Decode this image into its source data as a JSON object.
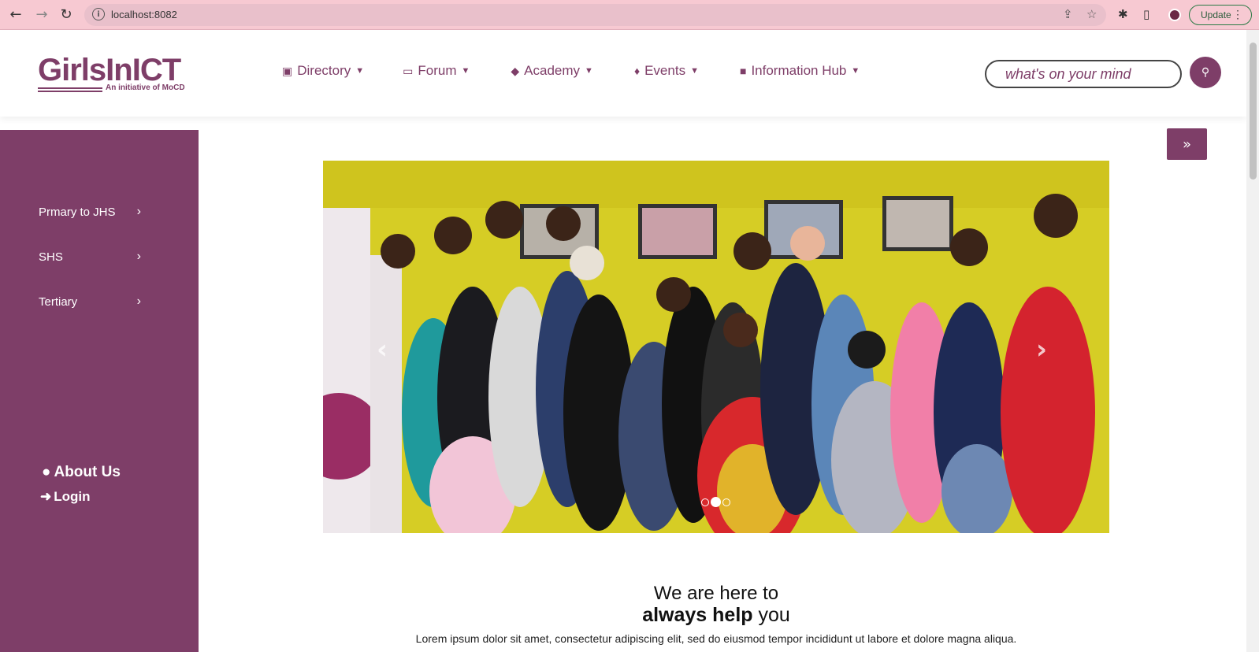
{
  "browser": {
    "url": "localhost:8082",
    "update_label": "Update"
  },
  "site": {
    "logo_text": "GirlsInICT",
    "logo_tagline": "An initiative of MoCD",
    "nav": [
      {
        "label": "Directory",
        "icon": "address-book-icon"
      },
      {
        "label": "Forum",
        "icon": "folder-open-icon"
      },
      {
        "label": "Academy",
        "icon": "graduation-cap-icon"
      },
      {
        "label": "Events",
        "icon": "fire-icon"
      },
      {
        "label": "Information Hub",
        "icon": "archive-icon"
      }
    ],
    "search_placeholder": "what's on your mind"
  },
  "sidebar": {
    "items": [
      {
        "label": "Prmary to JHS"
      },
      {
        "label": "SHS"
      },
      {
        "label": "Tertiary"
      }
    ],
    "about_label": "About Us",
    "login_label": "Login"
  },
  "carousel": {
    "slide_count": 3,
    "active_index": 1
  },
  "intro": {
    "line1": "We are here to",
    "line2_bold": "always help",
    "line2_rest": "you",
    "paragraph": "Lorem ipsum dolor sit amet, consectetur adipiscing elit, sed do eiusmod tempor incididunt ut labore et dolore magna aliqua."
  },
  "colors": {
    "brand": "#7e3e68",
    "chrome": "#f7c9d2"
  }
}
